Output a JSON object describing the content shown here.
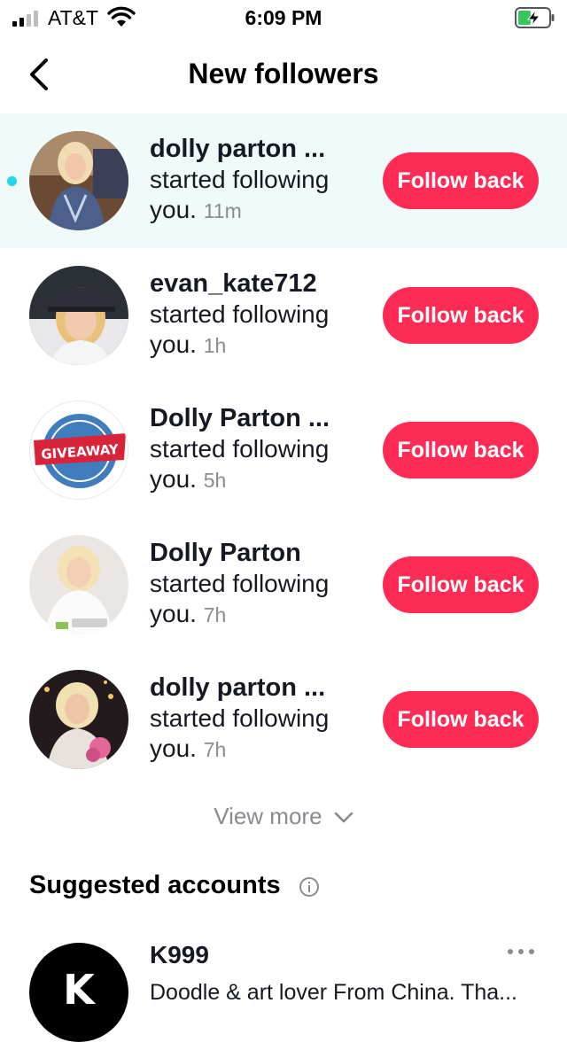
{
  "status_bar": {
    "carrier": "AT&T",
    "time": "6:09 PM",
    "icons": [
      "signal-icon",
      "wifi-icon",
      "battery-charging-icon"
    ]
  },
  "header": {
    "title": "New followers",
    "back_icon": "chevron-left-icon"
  },
  "followers": [
    {
      "name": "dolly parton ...",
      "message": "started following you.",
      "time": "11m",
      "button": "Follow back",
      "unread": true
    },
    {
      "name": "evan_kate712",
      "message": "started following you.",
      "time": "1h",
      "button": "Follow back",
      "unread": false
    },
    {
      "name": "Dolly Parton ...",
      "message": "started following you.",
      "time": "5h",
      "button": "Follow back",
      "unread": false
    },
    {
      "name": "Dolly Parton",
      "message": "started following you.",
      "time": "7h",
      "button": "Follow back",
      "unread": false
    },
    {
      "name": "dolly parton ...",
      "message": "started following you.",
      "time": "7h",
      "button": "Follow back",
      "unread": false
    }
  ],
  "view_more": "View more",
  "suggested": {
    "title": "Suggested accounts",
    "info_icon": "info-icon",
    "accounts": [
      {
        "name": "K999",
        "bio": "Doodle & art lover From China. Tha...",
        "avatar_letter": "K"
      }
    ]
  },
  "colors": {
    "accent": "#fe2c55",
    "unread_dot": "#20d5ec",
    "unread_bg": "#effaf9",
    "secondary_text": "#8a8b91"
  }
}
